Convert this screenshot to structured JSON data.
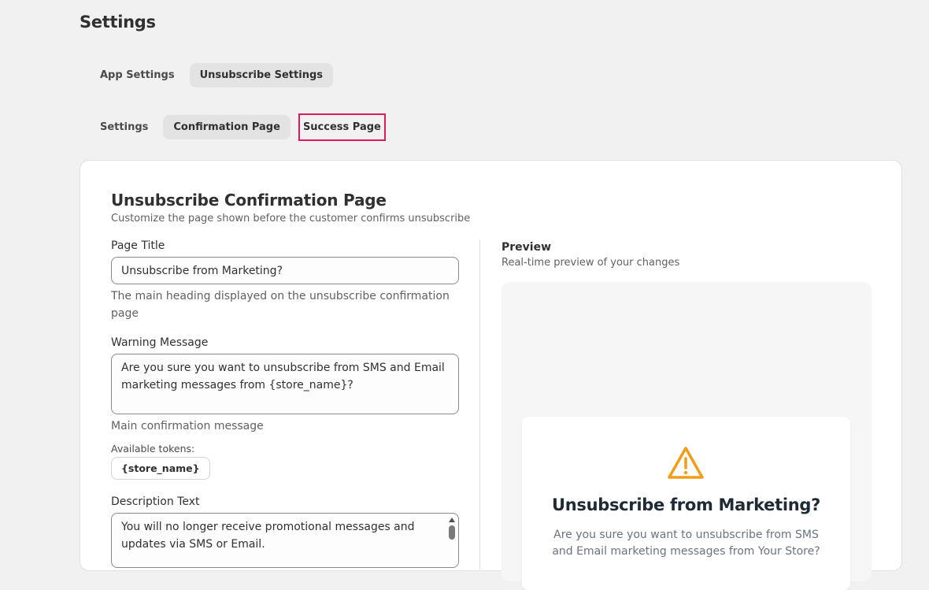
{
  "page": {
    "title": "Settings"
  },
  "primary_tabs": [
    {
      "label": "App Settings",
      "active": false
    },
    {
      "label": "Unsubscribe Settings",
      "active": true
    }
  ],
  "secondary_tabs": [
    {
      "label": "Settings",
      "active": false
    },
    {
      "label": "Confirmation Page",
      "active": true
    },
    {
      "label": "Success Page",
      "active": false,
      "highlighted": true
    }
  ],
  "card": {
    "title": "Unsubscribe Confirmation Page",
    "subtitle": "Customize the page shown before the customer confirms unsubscribe"
  },
  "form": {
    "page_title": {
      "label": "Page Title",
      "value": "Unsubscribe from Marketing?",
      "help": "The main heading displayed on the unsubscribe confirmation page"
    },
    "warning_message": {
      "label": "Warning Message",
      "value": "Are you sure you want to unsubscribe from SMS and Email marketing messages from {store_name}?",
      "help": "Main confirmation message",
      "tokens_label": "Available tokens:",
      "tokens": [
        "{store_name}"
      ]
    },
    "description_text": {
      "label": "Description Text",
      "value": "You will no longer receive promotional messages and updates via SMS or Email."
    }
  },
  "preview": {
    "heading": "Preview",
    "subheading": "Real-time preview of your changes",
    "icon": "warning-triangle-icon",
    "title": "Unsubscribe from Marketing?",
    "message": "Are you sure you want to unsubscribe from SMS and Email marketing messages from Your Store?"
  },
  "colors": {
    "background": "#f1f1f1",
    "card": "#ffffff",
    "highlight_outline": "#e0195f",
    "warning_icon": "#f29d13",
    "preview_title": "#1f2a37"
  }
}
